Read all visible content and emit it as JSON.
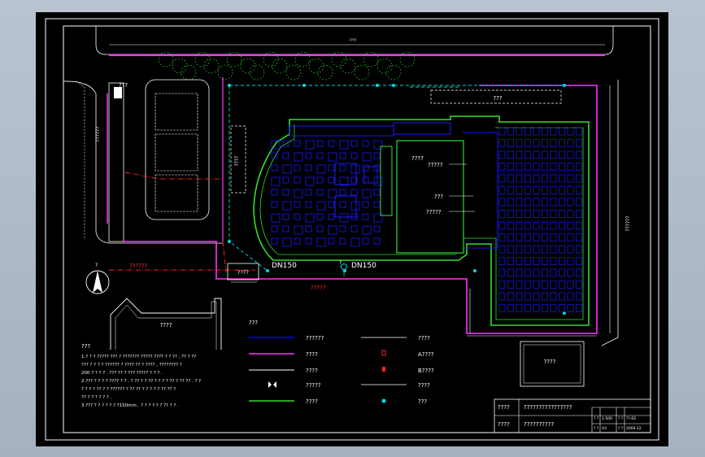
{
  "drawing": {
    "pipe_labels": {
      "dn150_left": "DN150",
      "dn150_right": "DN150"
    },
    "room_labels": {
      "stage": "????",
      "room_a": "?????",
      "room_b": "???",
      "room_c": "?????",
      "top_right_box": "???",
      "left_vertical": "??????",
      "left_box_top": "???",
      "valve_box": "????",
      "left_small_box": "????",
      "mid_vertical": "????",
      "bottom_right_box": "????",
      "right_vertical": "??????",
      "road_label_left": "??????",
      "road_label_bottom": "?????",
      "outline_label": "????",
      "north_arrow": "?"
    },
    "legend": {
      "title": "???",
      "items_left": [
        "??????",
        "????",
        "????",
        "?????",
        "????"
      ],
      "items_right": [
        "????",
        "A????",
        "B????",
        "????",
        "???"
      ]
    },
    "notes": {
      "title": "???",
      "lines": [
        "1.? ? ? ?????  ??? ? ??????? ????? ???? ? ? ?? , ?? ? ??",
        "??? ? ? ? ? ?????? ? ???? ?? ? ???? , ???????? ?",
        "200 ? ? ? ? . ??? ?? ? ??? ????? ? ? ? .",
        "2.??? ? ? ? ? ???? ? ? . ? ?? ? ? ?? ? ? ? ? ?? ? ?? ?? . ? ?",
        "? ? ? ? ?? ? ? ?????? ? ?? ?? ? ? ? ? ? ?? ?? ?",
        "?? ? ? ? ? ? ? .",
        "3.??? ? ? ? ? ? ? ?150mm . ? ? ? ? ? ? ?? ? ? ."
      ]
    },
    "title_block": {
      "row1_label": "????",
      "row1_title": "????????????????",
      "row2_label": "????",
      "row2_title": "??????????",
      "cell_a1": "? ?",
      "cell_a2": "1:500",
      "cell_a3": "? ?",
      "cell_a4": "??-02",
      "cell_b1": "? ?",
      "cell_b2": "A3",
      "cell_b3": "? ?",
      "cell_b4": "2004.12"
    },
    "colors": {
      "building": "#0000ff",
      "wall_green": "#33dd33",
      "water_magenta": "#ff33ff",
      "red_pipe": "#ff2020",
      "cyan_pipe": "#00dddd",
      "frame_white": "#ffffff"
    }
  }
}
